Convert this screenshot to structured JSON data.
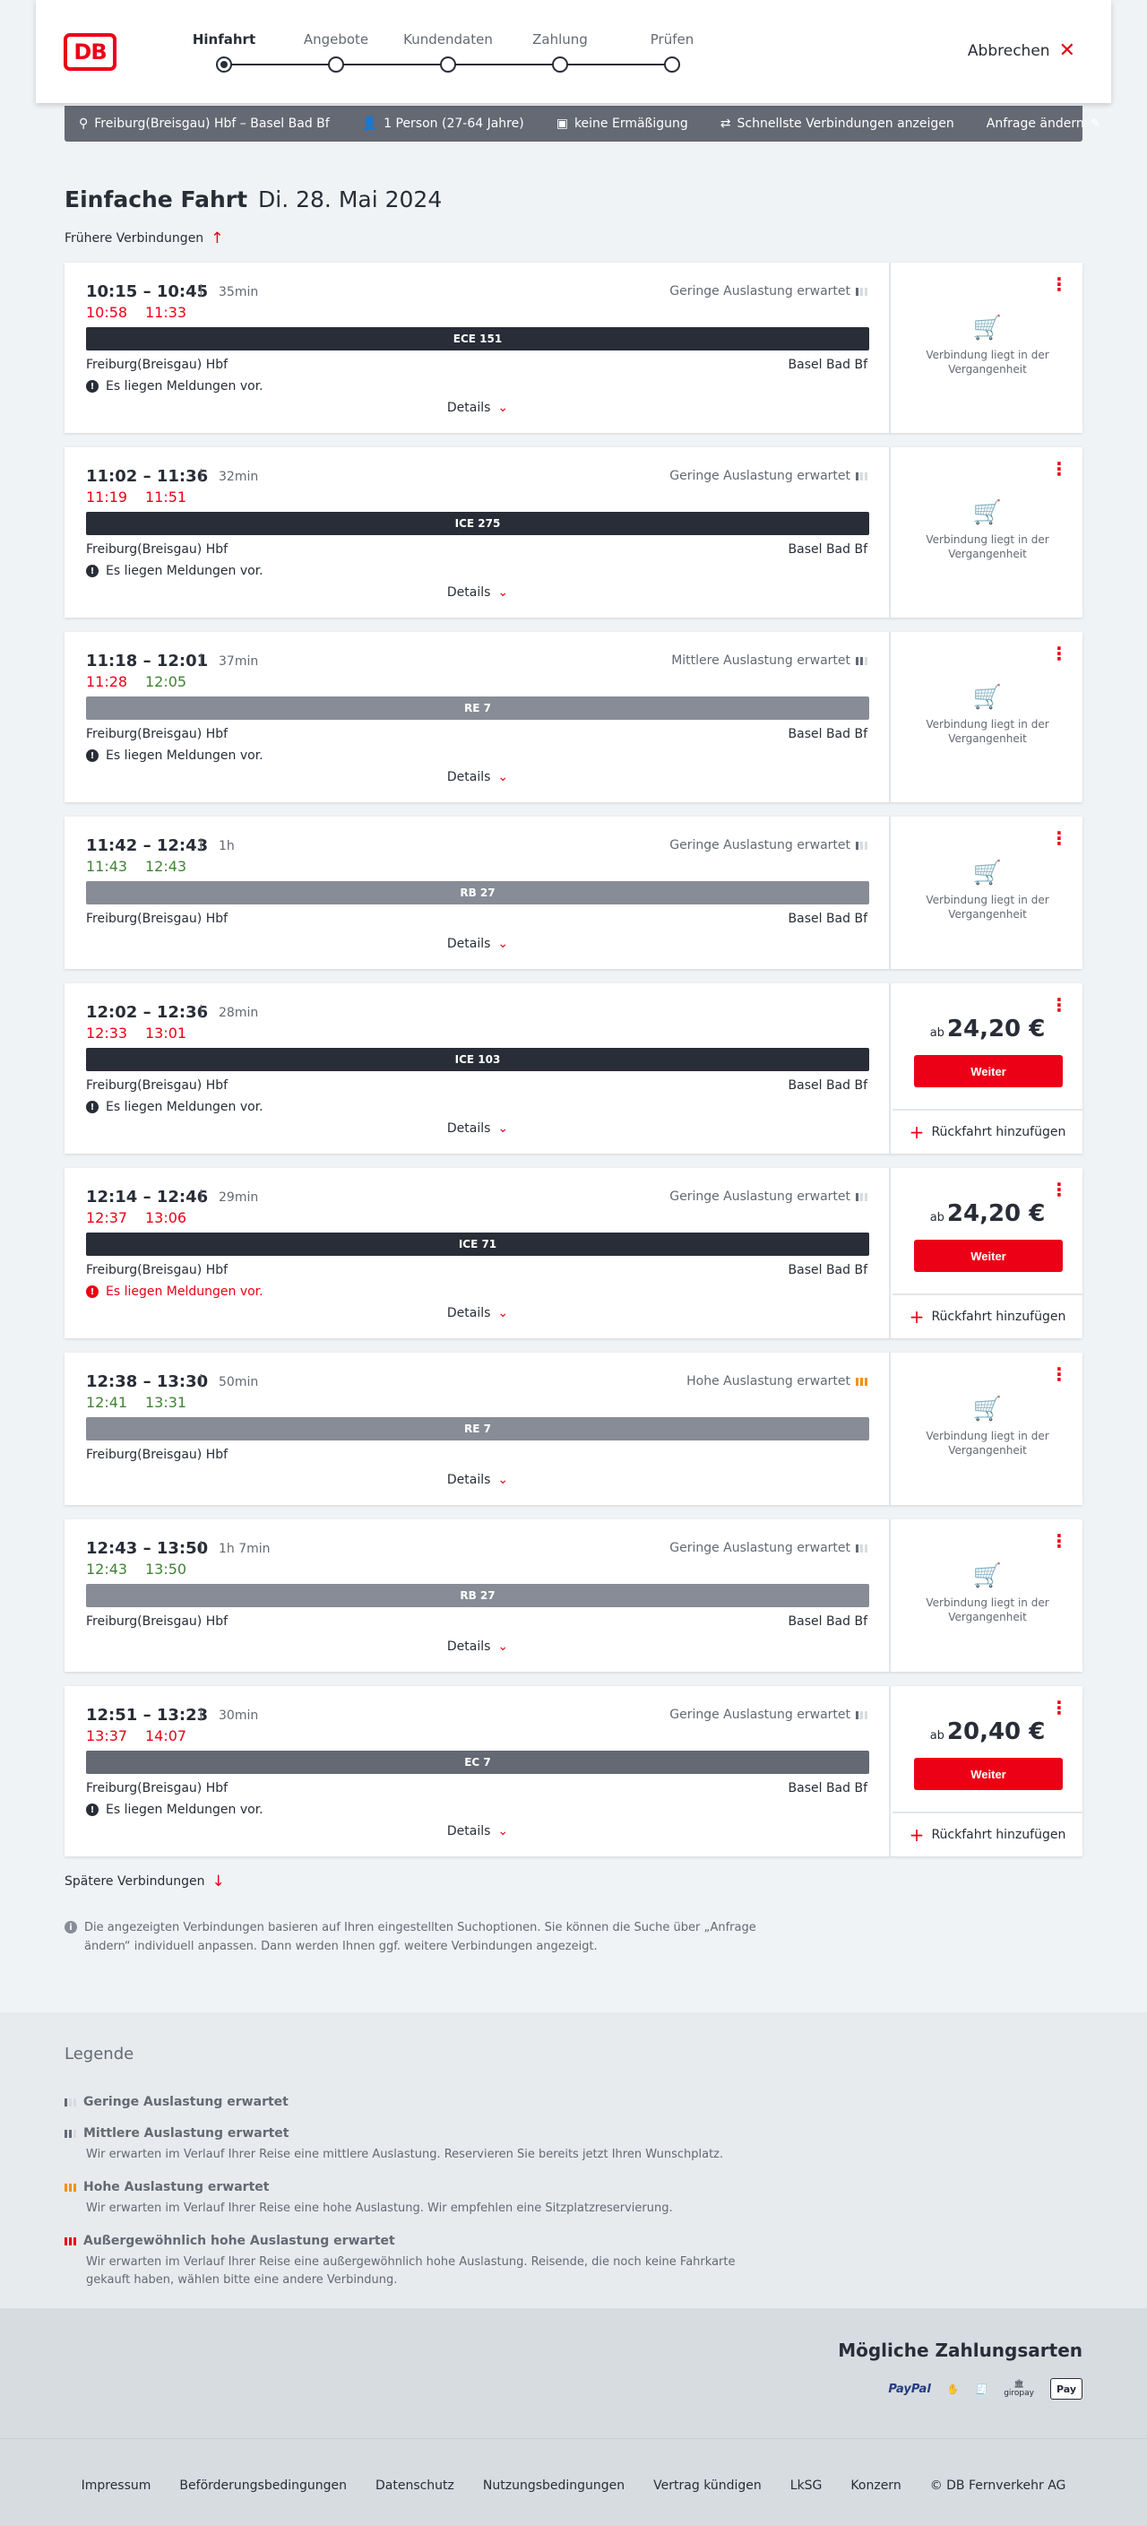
{
  "header": {
    "logo": "DB",
    "steps": [
      {
        "label": "Hinfahrt",
        "active": true
      },
      {
        "label": "Angebote",
        "active": false
      },
      {
        "label": "Kundendaten",
        "active": false
      },
      {
        "label": "Zahlung",
        "active": false
      },
      {
        "label": "Prüfen",
        "active": false
      }
    ],
    "cancel_label": "Abbrechen"
  },
  "query": {
    "route": "Freiburg(Breisgau) Hbf – Basel Bad Bf",
    "persons": "1 Person (27-64 Jahre)",
    "discount": "keine Ermäßigung",
    "fastest": "Schnellste Verbindungen anzeigen",
    "change": "Anfrage ändern"
  },
  "page": {
    "title": "Einfache Fahrt",
    "date": "Di. 28. Mai 2024",
    "earlier": "Frühere Verbindungen",
    "later": "Spätere Verbindungen",
    "details": "Details",
    "past_text": "Verbindung liegt in der Vergangenheit",
    "ab": "ab",
    "weiter": "Weiter",
    "return": "Rückfahrt hinzufügen",
    "info": "Die angezeigten Verbindungen basieren auf Ihren eingestellten Suchoptionen. Sie können die Suche über „Anfrage ändern“ individuell anpassen. Dann werden Ihnen ggf. weitere Verbindungen angezeigt."
  },
  "connections": [
    {
      "times": "10:15 – 10:45",
      "duration": "35min",
      "rt1": "10:58",
      "rt2": "11:33",
      "rt_status": "late",
      "util": "Geringe Auslastung erwartet",
      "util_level": 1,
      "train": "ECE 151",
      "train_type": "long",
      "from": "Freiburg(Breisgau) Hbf",
      "to": "Basel Bad Bf",
      "msg": "Es liegen Meldungen vor.",
      "msg_red": false,
      "state": "past"
    },
    {
      "times": "11:02 – 11:36",
      "duration": "32min",
      "rt1": "11:19",
      "rt2": "11:51",
      "rt_status": "late",
      "util": "Geringe Auslastung erwartet",
      "util_level": 1,
      "train": "ICE 275",
      "train_type": "long",
      "from": "Freiburg(Breisgau) Hbf",
      "to": "Basel Bad Bf",
      "msg": "Es liegen Meldungen vor.",
      "msg_red": false,
      "state": "past"
    },
    {
      "times": "11:18 – 12:01",
      "duration": "37min",
      "rt1": "11:28",
      "rt2": "12:05",
      "rt_status": "mixed",
      "util": "Mittlere Auslastung erwartet",
      "util_level": 2,
      "train": "RE 7",
      "train_type": "reg",
      "from": "Freiburg(Breisgau) Hbf",
      "to": "Basel Bad Bf",
      "msg": "Es liegen Meldungen vor.",
      "msg_red": false,
      "state": "past"
    },
    {
      "times": "11:42 – 12:43",
      "duration": "1h",
      "rt1": "11:43",
      "rt2": "12:43",
      "rt_status": "ok",
      "util": "Geringe Auslastung erwartet",
      "util_level": 1,
      "train": "RB 27",
      "train_type": "reg",
      "from": "Freiburg(Breisgau) Hbf",
      "to": "Basel Bad Bf",
      "msg": "",
      "msg_red": false,
      "state": "past"
    },
    {
      "times": "12:02 – 12:36",
      "duration": "28min",
      "rt1": "12:33",
      "rt2": "13:01",
      "rt_status": "late",
      "util": "",
      "util_level": 0,
      "train": "ICE 103",
      "train_type": "long",
      "from": "Freiburg(Breisgau) Hbf",
      "to": "Basel Bad Bf",
      "msg": "Es liegen Meldungen vor.",
      "msg_red": false,
      "state": "price",
      "price": "24,20 €"
    },
    {
      "times": "12:14 – 12:46",
      "duration": "29min",
      "rt1": "12:37",
      "rt2": "13:06",
      "rt_status": "late",
      "util": "Geringe Auslastung erwartet",
      "util_level": 1,
      "train": "ICE 71",
      "train_type": "long",
      "from": "Freiburg(Breisgau) Hbf",
      "to": "Basel Bad Bf",
      "msg": "Es liegen Meldungen vor.",
      "msg_red": true,
      "state": "price",
      "price": "24,20 €"
    },
    {
      "times": "12:38 – 13:30",
      "duration": "50min",
      "rt1": "12:41",
      "rt2": "13:31",
      "rt_status": "ok",
      "util": "Hohe Auslastung erwartet",
      "util_level": 3,
      "train": "RE 7",
      "train_type": "reg",
      "from": "Freiburg(Breisgau) Hbf",
      "to": "",
      "msg": "",
      "msg_red": false,
      "state": "past"
    },
    {
      "times": "12:43 – 13:50",
      "duration": "1h 7min",
      "rt1": "12:43",
      "rt2": "13:50",
      "rt_status": "ok",
      "util": "Geringe Auslastung erwartet",
      "util_level": 1,
      "train": "RB 27",
      "train_type": "reg",
      "from": "Freiburg(Breisgau) Hbf",
      "to": "Basel Bad Bf",
      "msg": "",
      "msg_red": false,
      "state": "past"
    },
    {
      "times": "12:51 – 13:23",
      "duration": "30min",
      "rt1": "13:37",
      "rt2": "14:07",
      "rt_status": "late",
      "util": "Geringe Auslastung erwartet",
      "util_level": 1,
      "train": "EC 7",
      "train_type": "ec",
      "from": "Freiburg(Breisgau) Hbf",
      "to": "Basel Bad Bf",
      "msg": "Es liegen Meldungen vor.",
      "msg_red": false,
      "state": "price",
      "price": "20,40 €"
    }
  ],
  "legend": {
    "title": "Legende",
    "items": [
      {
        "title": "Geringe Auslastung erwartet",
        "level": 1,
        "desc": ""
      },
      {
        "title": "Mittlere Auslastung erwartet",
        "level": 2,
        "desc": "Wir erwarten im Verlauf Ihrer Reise eine mittlere Auslastung. Reservieren Sie bereits jetzt Ihren Wunschplatz."
      },
      {
        "title": "Hohe Auslastung erwartet",
        "level": 3,
        "desc": "Wir erwarten im Verlauf Ihrer Reise eine hohe Auslastung. Wir empfehlen eine Sitzplatzreservierung."
      },
      {
        "title": "Außergewöhnlich hohe Auslastung erwartet",
        "level": 4,
        "desc": "Wir erwarten im Verlauf Ihrer Reise eine außergewöhnlich hohe Auslastung. Reisende, die noch keine Fahrkarte gekauft haben, wählen bitte eine andere Verbindung."
      }
    ]
  },
  "payment": {
    "title": "Mögliche Zahlungsarten",
    "methods": [
      "PayPal",
      "giropay",
      "Pay"
    ]
  },
  "footer": {
    "links": [
      "Impressum",
      "Beförderungsbedingungen",
      "Datenschutz",
      "Nutzungsbedingungen",
      "Vertrag kündigen",
      "LkSG",
      "Konzern",
      "© DB Fernverkehr AG"
    ]
  },
  "colors": {
    "brand": "#ec0016",
    "late": "#ec0016",
    "on_time": "#408335",
    "dark": "#282d37"
  }
}
